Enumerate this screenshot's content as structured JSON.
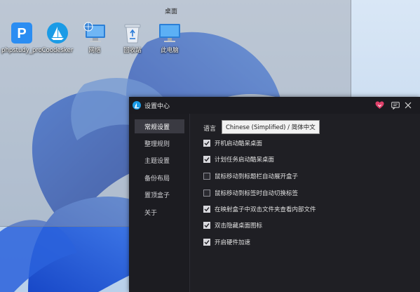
{
  "desktop": {
    "label": "桌面",
    "icons": [
      {
        "name": "phpstudy",
        "label": "phpstudy_pro",
        "icon": "phpstudy-icon"
      },
      {
        "name": "codesker",
        "label": "Coodesker",
        "icon": "coodesker-icon"
      },
      {
        "name": "network",
        "label": "网络",
        "icon": "network-icon"
      },
      {
        "name": "recycle-bin",
        "label": "回收站",
        "icon": "recycle-bin-icon"
      },
      {
        "name": "this-pc",
        "label": "此电脑",
        "icon": "computer-icon"
      }
    ]
  },
  "window": {
    "title": "设置中心",
    "icons": [
      "heart-icon",
      "message-icon",
      "close-icon"
    ],
    "accent_color": "#e0406a"
  },
  "sidebar": {
    "items": [
      {
        "label": "常规设置",
        "active": true
      },
      {
        "label": "整理规则",
        "active": false
      },
      {
        "label": "主题设置",
        "active": false
      },
      {
        "label": "备份布局",
        "active": false
      },
      {
        "label": "置顶盒子",
        "active": false
      },
      {
        "label": "关于",
        "active": false
      }
    ]
  },
  "settings": {
    "language_label": "语言",
    "language_value": "Chinese (Simplified) / 简体中文",
    "options": [
      {
        "label": "开机启动酷呆桌面",
        "checked": true
      },
      {
        "label": "计划任务启动酷呆桌面",
        "checked": true
      },
      {
        "label": "鼠标移动到标题栏自动展开盒子",
        "checked": false
      },
      {
        "label": "鼠标移动到标签时自动切换标签",
        "checked": false
      },
      {
        "label": "在映射盒子中双击文件夹查看内部文件",
        "checked": true
      },
      {
        "label": "双击隐藏桌面图标",
        "checked": true
      },
      {
        "label": "开启硬件加速",
        "checked": true
      }
    ]
  }
}
